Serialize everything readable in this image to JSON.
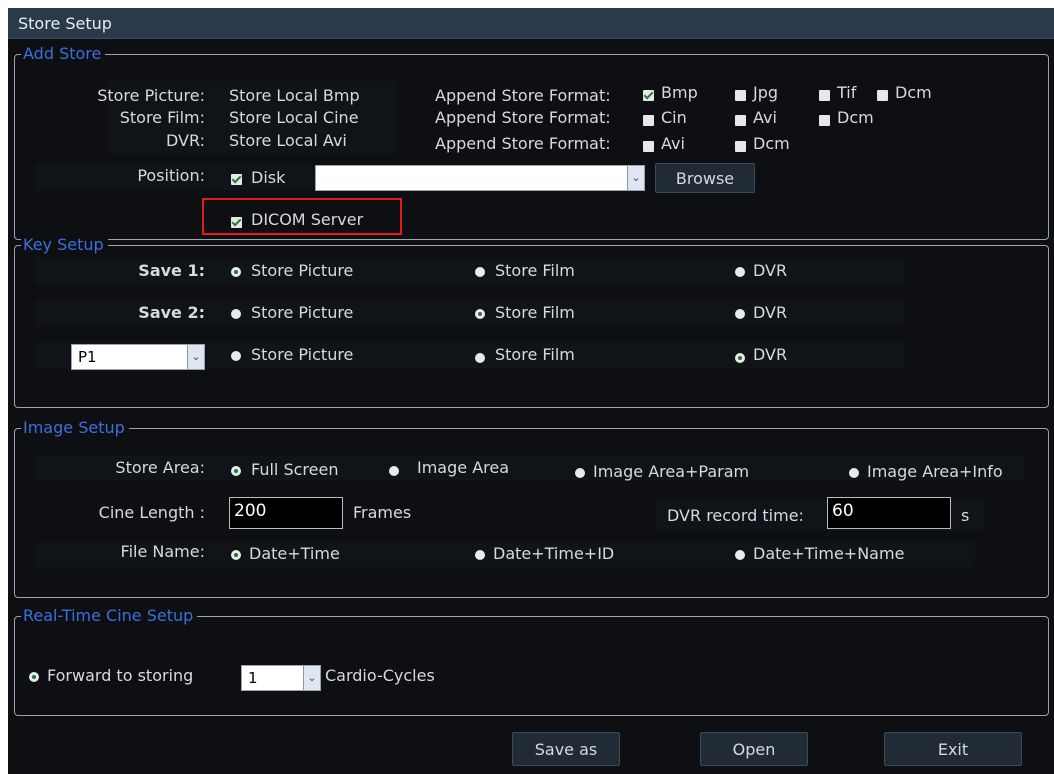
{
  "window": {
    "title": "Store Setup"
  },
  "add_store": {
    "legend": "Add Store",
    "store_picture": {
      "label": "Store Picture:",
      "value": "Store Local Bmp"
    },
    "store_film": {
      "label": "Store Film:",
      "value": "Store Local Cine"
    },
    "dvr": {
      "label": "DVR:",
      "value": "Store Local Avi"
    },
    "append_label": "Append Store Format:",
    "picture_formats": [
      {
        "label": "Bmp",
        "checked": true
      },
      {
        "label": "Jpg",
        "checked": false
      },
      {
        "label": "Tif",
        "checked": false
      },
      {
        "label": "Dcm",
        "checked": false
      }
    ],
    "film_formats": [
      {
        "label": "Cin",
        "checked": false
      },
      {
        "label": "Avi",
        "checked": false
      },
      {
        "label": "Dcm",
        "checked": false
      }
    ],
    "dvr_formats": [
      {
        "label": "Avi",
        "checked": false
      },
      {
        "label": "Dcm",
        "checked": false
      }
    ],
    "position_label": "Position:",
    "disk": {
      "label": "Disk",
      "checked": true
    },
    "path_value": "",
    "browse_label": "Browse",
    "dicom_server": {
      "label": "DICOM Server",
      "checked": true
    }
  },
  "key_setup": {
    "legend": "Key Setup",
    "rows": [
      {
        "label": "Save 1:",
        "options": [
          "Store Picture",
          "Store Film",
          "DVR"
        ],
        "selected": 0
      },
      {
        "label": "Save 2:",
        "options": [
          "Store Picture",
          "Store Film",
          "DVR"
        ],
        "selected": 1
      },
      {
        "combo_value": "P1",
        "options": [
          "Store Picture",
          "Store Film",
          "DVR"
        ],
        "selected": 2
      }
    ]
  },
  "image_setup": {
    "legend": "Image Setup",
    "store_area_label": "Store Area:",
    "store_area_options": [
      "Full Screen",
      "Image Area",
      "Image Area+Param",
      "Image Area+Info"
    ],
    "store_area_selected": 0,
    "cine_length_label": "Cine Length :",
    "cine_length_value": "200",
    "frames_label": "Frames",
    "dvr_time_label": "DVR record time:",
    "dvr_time_value": "60",
    "dvr_time_unit": "s",
    "file_name_label": "File Name:",
    "file_name_options": [
      "Date+Time",
      "Date+Time+ID",
      "Date+Time+Name"
    ],
    "file_name_selected": 0
  },
  "realtime": {
    "legend": "Real-Time Cine Setup",
    "forward_label": "Forward to storing",
    "forward_selected": true,
    "cycles_value": "1",
    "cycles_label": "Cardio-Cycles"
  },
  "buttons": {
    "save_as": "Save as",
    "open": "Open",
    "exit": "Exit"
  },
  "colors": {
    "background": "#0d0f12",
    "title_bar": "#2b3a4b",
    "legend_text": "#3b6fe0",
    "highlight_box": "#e31b1b"
  }
}
